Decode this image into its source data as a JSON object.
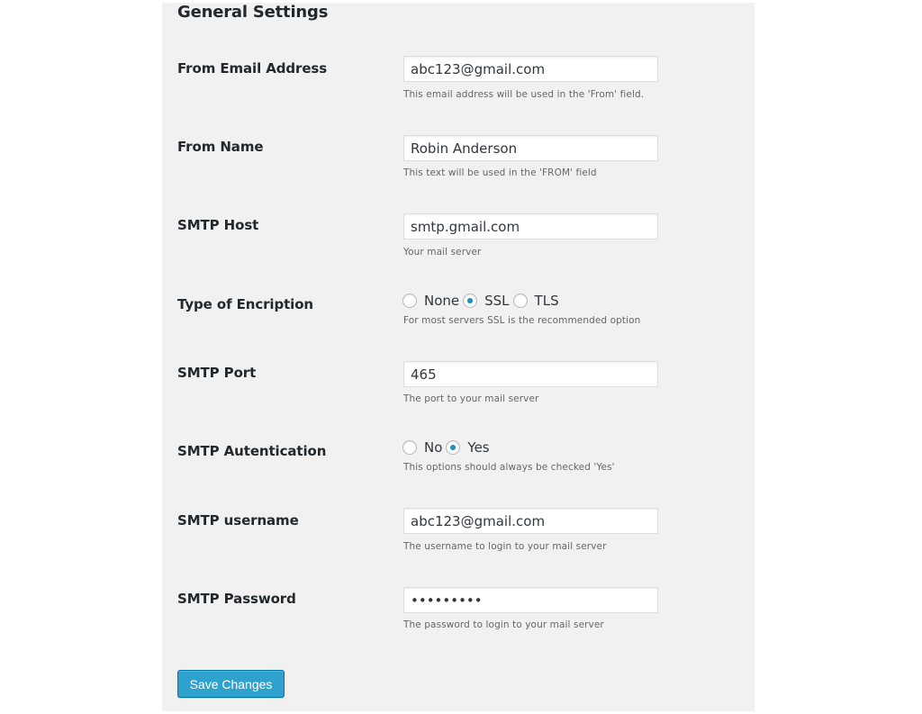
{
  "section_title": "General Settings",
  "fields": {
    "from_email": {
      "label": "From Email Address",
      "value": "abc123@gmail.com",
      "description": "This email address will be used in the 'From' field."
    },
    "from_name": {
      "label": "From Name",
      "value": "Robin Anderson",
      "description": "This text will be used in the 'FROM' field"
    },
    "smtp_host": {
      "label": "SMTP Host",
      "value": "smtp.gmail.com",
      "description": "Your mail server"
    },
    "encryption": {
      "label": "Type of Encription",
      "options": [
        "None",
        "SSL",
        "TLS"
      ],
      "selected": "SSL",
      "description": "For most servers SSL is the recommended option"
    },
    "smtp_port": {
      "label": "SMTP Port",
      "value": "465",
      "description": "The port to your mail server"
    },
    "authentication": {
      "label": "SMTP Autentication",
      "options": [
        "No",
        "Yes"
      ],
      "selected": "Yes",
      "description": "This options should always be checked 'Yes'"
    },
    "smtp_username": {
      "label": "SMTP username",
      "value": "abc123@gmail.com",
      "description": "The username to login to your mail server"
    },
    "smtp_password": {
      "label": "SMTP Password",
      "value": "•••••••••",
      "description": "The password to login to your mail server"
    }
  },
  "save_button": {
    "label": "Save Changes",
    "color": "#2ea2cc"
  },
  "colors": {
    "panel_bg": "#f1f1f1",
    "radio_checked": "#1e8cbe"
  }
}
